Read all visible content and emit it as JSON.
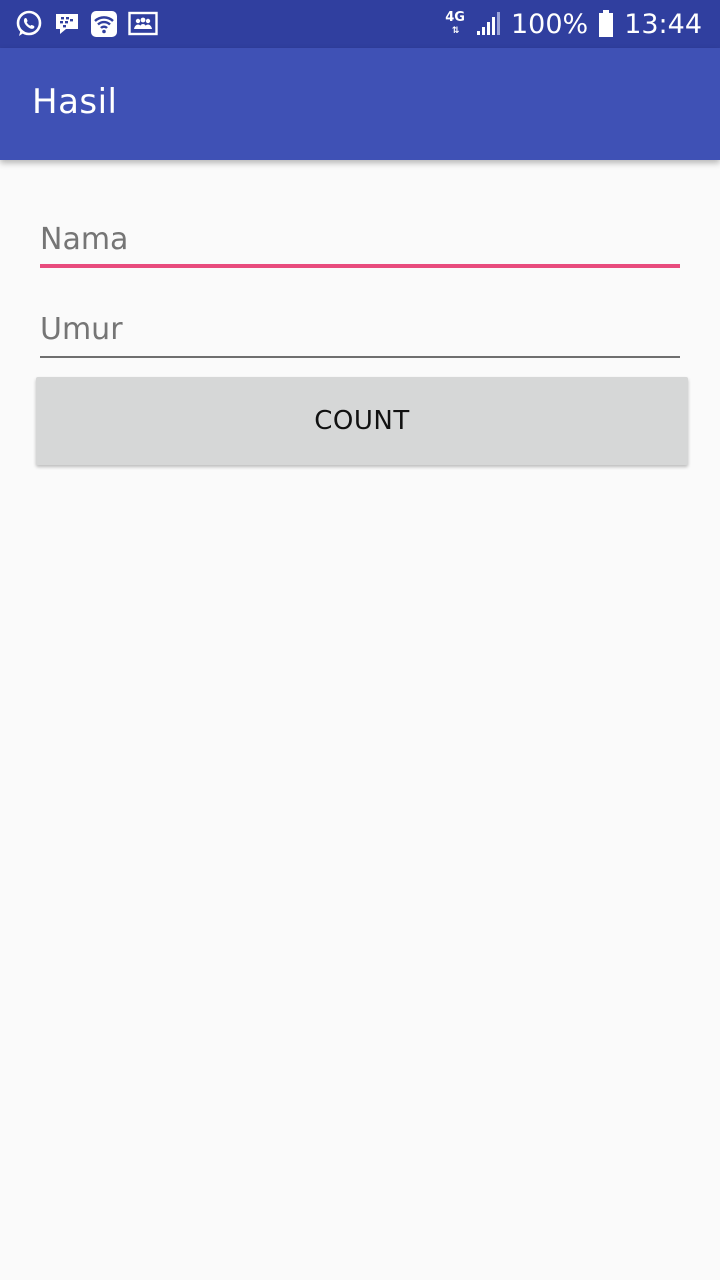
{
  "status_bar": {
    "left_icons": [
      "whatsapp-icon",
      "bbm-icon",
      "wifi-icon",
      "notification-icon"
    ],
    "network_type": "4G",
    "battery_percent": "100%",
    "time": "13:44"
  },
  "app_bar": {
    "title": "Hasil"
  },
  "form": {
    "name_placeholder": "Nama",
    "name_value": "",
    "age_placeholder": "Umur",
    "age_value": "",
    "count_label": "COUNT"
  },
  "colors": {
    "status_bar": "#303f9f",
    "app_bar": "#3f51b5",
    "accent": "#e84b7d",
    "background": "#fafafa",
    "button": "#d6d7d7"
  }
}
